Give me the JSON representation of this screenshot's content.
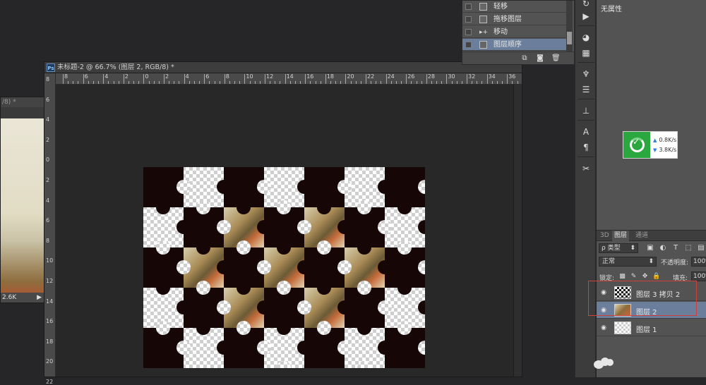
{
  "back_document": {
    "title": "/8) *",
    "status": "2.6K"
  },
  "main_document": {
    "title": "未标题-2 @ 66.7% (图层 2, RGB/8) *",
    "ps_badge": "Ps",
    "ruler_top_numbers": [
      "8",
      "6",
      "4",
      "2",
      "0",
      "2",
      "4",
      "6",
      "8",
      "10",
      "12",
      "14",
      "16",
      "18",
      "20",
      "22",
      "24",
      "26",
      "28",
      "30",
      "32",
      "34",
      "36"
    ],
    "ruler_left_numbers": [
      "8",
      "6",
      "4",
      "2",
      "0",
      "2",
      "4",
      "6",
      "8",
      "10",
      "12",
      "14",
      "16",
      "18",
      "20",
      "22"
    ]
  },
  "history_panel": {
    "items": [
      {
        "label": "轻移",
        "icon": "document-icon",
        "selected": false
      },
      {
        "label": "拖移图层",
        "icon": "document-icon",
        "selected": false
      },
      {
        "label": "移动",
        "icon": "move-tool-icon",
        "selected": false
      },
      {
        "label": "图层顺序",
        "icon": "document-icon",
        "selected": true
      }
    ],
    "footer_icons": [
      "new-document-from-state-icon",
      "snapshot-icon",
      "trash-icon"
    ]
  },
  "tool_strip": {
    "tools": [
      "history-icon",
      "play-icon",
      "palette-icon",
      "grid-icon",
      "brush-preset-icon",
      "sliders-icon",
      "stamp-icon",
      "character-icon",
      "paragraph-icon",
      "tool-preset-icon"
    ]
  },
  "properties_panel": {
    "label": "无属性"
  },
  "network_widget": {
    "upload": "0.8K/s",
    "download": "3.8K/s",
    "accent": "#2aa73f"
  },
  "layers_panel": {
    "tabs": [
      {
        "label": "3D",
        "active": false
      },
      {
        "label": "图层",
        "active": true
      },
      {
        "label": "通道",
        "active": false
      }
    ],
    "filter_label": "类型",
    "blend_mode": "正常",
    "opacity_label": "不透明度:",
    "opacity_value": "100%",
    "lock_label": "锁定:",
    "fill_label": "填充:",
    "fill_value": "100%",
    "layers": [
      {
        "name": "图层 3 拷贝 2",
        "thumb": "puzzle",
        "selected": false
      },
      {
        "name": "图层 2",
        "thumb": "image",
        "selected": true
      },
      {
        "name": "图层 1",
        "thumb": "transparent",
        "selected": false
      }
    ],
    "highlight_color": "#d0403a",
    "selection_color": "#6b7f9c"
  }
}
